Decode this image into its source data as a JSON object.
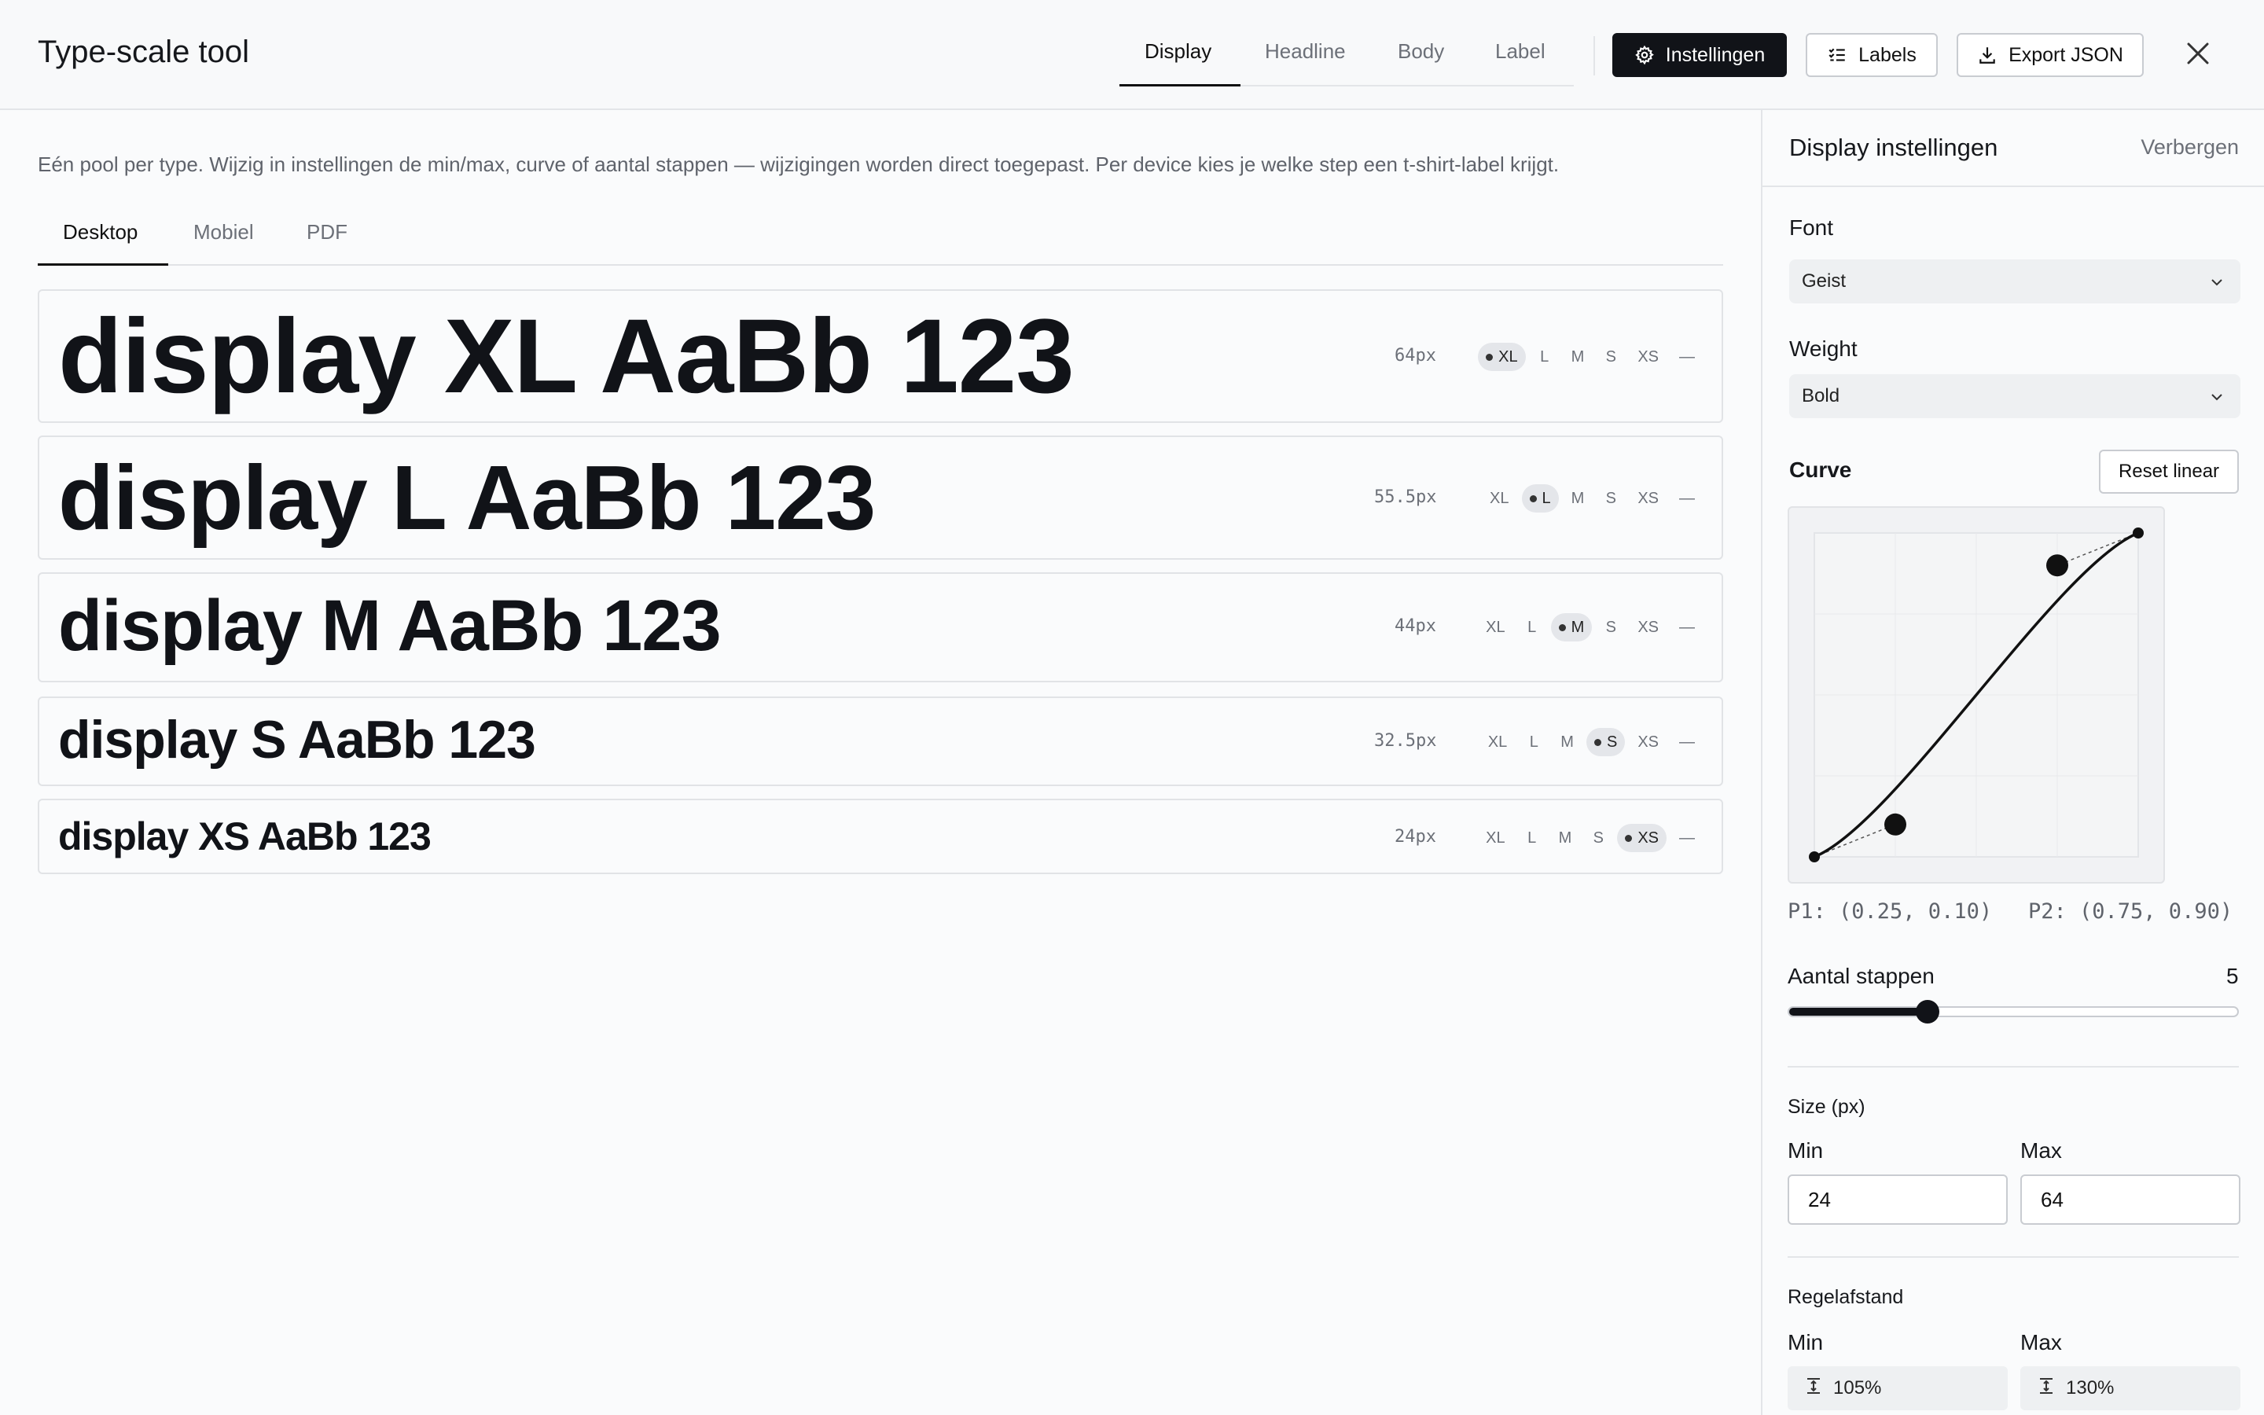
{
  "app": {
    "title": "Type-scale tool"
  },
  "main_tabs": [
    {
      "label": "Display",
      "active": true
    },
    {
      "label": "Headline",
      "active": false
    },
    {
      "label": "Body",
      "active": false
    },
    {
      "label": "Label",
      "active": false
    }
  ],
  "toolbar": {
    "settings_label": "Instellingen",
    "labels_label": "Labels",
    "export_label": "Export JSON"
  },
  "intro": "Eén pool per type. Wijzig in instellingen de min/max, curve of aantal stappen — wijzigingen worden direct toegepast. Per device kies je welke step een t-shirt-label krijgt.",
  "device_tabs": [
    {
      "label": "Desktop",
      "active": true
    },
    {
      "label": "Mobiel",
      "active": false
    },
    {
      "label": "PDF",
      "active": false
    }
  ],
  "chip_labels": [
    "XL",
    "L",
    "M",
    "S",
    "XS",
    "—"
  ],
  "steps": [
    {
      "sample": "display XL AaBb 123",
      "size": "64px",
      "selected": "XL"
    },
    {
      "sample": "display L AaBb 123",
      "size": "55.5px",
      "selected": "L"
    },
    {
      "sample": "display M AaBb 123",
      "size": "44px",
      "selected": "M"
    },
    {
      "sample": "display S AaBb 123",
      "size": "32.5px",
      "selected": "S"
    },
    {
      "sample": "display XS AaBb 123",
      "size": "24px",
      "selected": "XS"
    }
  ],
  "panel": {
    "title": "Display instellingen",
    "hide": "Verbergen",
    "font_label": "Font",
    "font_value": "Geist",
    "weight_label": "Weight",
    "weight_value": "Bold",
    "curve_label": "Curve",
    "reset_label": "Reset linear",
    "p1": "P1: (0.25, 0.10)",
    "p2": "P2: (0.75, 0.90)",
    "curve_points": {
      "p1": [
        0.25,
        0.1
      ],
      "p2": [
        0.75,
        0.9
      ]
    },
    "steps_label": "Aantal stappen",
    "steps_value": "5",
    "steps_fraction": 0.31,
    "size_label": "Size (px)",
    "size_min_label": "Min",
    "size_max_label": "Max",
    "size_min": "24",
    "size_max": "64",
    "leading_label": "Regelafstand",
    "leading_min_label": "Min",
    "leading_max_label": "Max",
    "leading_min": "105%",
    "leading_max": "130%"
  },
  "colors": {
    "accent": "#111318",
    "chip_selected": "#e4e6ea",
    "border": "#e1e3e6"
  }
}
